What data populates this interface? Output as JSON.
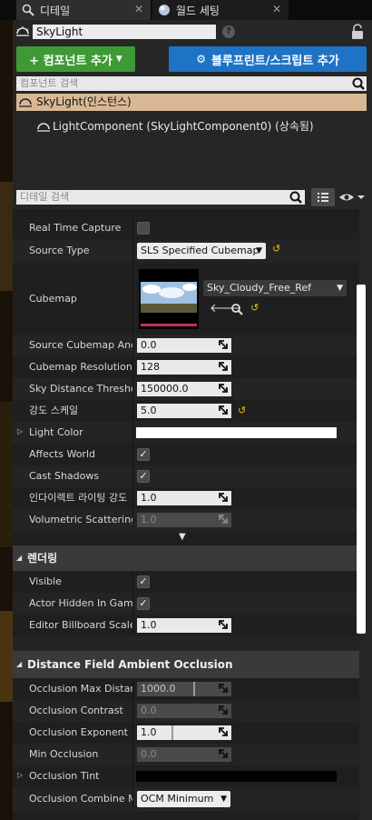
{
  "tabs": [
    {
      "label": "디테일"
    },
    {
      "label": "월드 세팅"
    }
  ],
  "actor": {
    "name": "SkyLight"
  },
  "buttons": {
    "add_component": "+ 컴포넌트 추가",
    "blueprint": "블루프린트/스크립트 추가"
  },
  "component_search": {
    "placeholder": "컴포넌트 검색"
  },
  "tree": {
    "root": "SkyLight(인스턴스)",
    "child": "LightComponent (SkyLightComponent0) (상속됨)"
  },
  "details_search": {
    "placeholder": "디테일 검색"
  },
  "properties": {
    "real_time_capture": {
      "label": "Real Time Capture",
      "checked": false
    },
    "source_type": {
      "label": "Source Type",
      "value": "SLS Specified Cubemap"
    },
    "cubemap": {
      "label": "Cubemap",
      "asset": "Sky_Cloudy_Free_Ref"
    },
    "source_cubemap_angle": {
      "label": "Source Cubemap Angle",
      "value": "0.0"
    },
    "cubemap_resolution": {
      "label": "Cubemap Resolution",
      "value": "128"
    },
    "sky_distance_threshold": {
      "label": "Sky Distance Threshold",
      "value": "150000.0"
    },
    "intensity_scale": {
      "label": "강도 스케일",
      "value": "5.0"
    },
    "light_color": {
      "label": "Light Color",
      "color": "#ffffff"
    },
    "affects_world": {
      "label": "Affects World",
      "checked": true
    },
    "cast_shadows": {
      "label": "Cast Shadows",
      "checked": true
    },
    "indirect_lighting": {
      "label": "인다이렉트 라이팅 강도",
      "value": "1.0"
    },
    "volumetric_scattering": {
      "label": "Volumetric Scattering",
      "value": "1.0"
    }
  },
  "rendering": {
    "title": "렌더링",
    "visible": {
      "label": "Visible",
      "checked": true
    },
    "actor_hidden": {
      "label": "Actor Hidden In Game",
      "checked": true
    },
    "billboard_scale": {
      "label": "Editor Billboard Scale",
      "value": "1.0"
    }
  },
  "dfao": {
    "title": "Distance Field Ambient Occlusion",
    "max_distance": {
      "label": "Occlusion Max Distance",
      "value": "1000.0"
    },
    "contrast": {
      "label": "Occlusion Contrast",
      "value": "0.0"
    },
    "exponent": {
      "label": "Occlusion Exponent",
      "value": "1.0"
    },
    "min_occlusion": {
      "label": "Min Occlusion",
      "value": "0.0"
    },
    "tint": {
      "label": "Occlusion Tint",
      "color": "#000000"
    },
    "combine_mode": {
      "label": "Occlusion Combine Mode",
      "value": "OCM Minimum"
    }
  }
}
